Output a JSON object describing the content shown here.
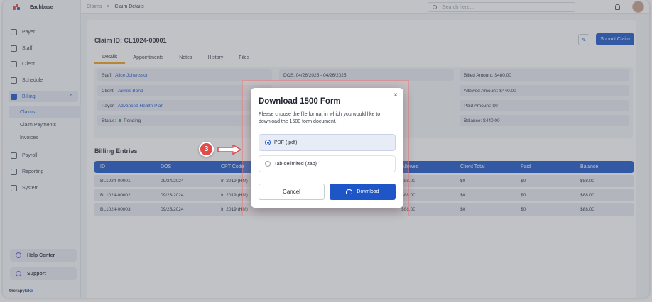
{
  "app": {
    "name": "Eachbase"
  },
  "colors": {
    "primary": "#1e56c8",
    "accent_tab": "#f0a017",
    "step_badge": "#e34b4b",
    "status_pending": "#2e9e4f"
  },
  "sidebar": {
    "items": [
      {
        "label": "Payer",
        "icon": "payer-icon"
      },
      {
        "label": "Staff",
        "icon": "staff-icon"
      },
      {
        "label": "Client",
        "icon": "client-icon"
      },
      {
        "label": "Schedule",
        "icon": "calendar-icon"
      },
      {
        "label": "Billing",
        "icon": "billing-icon",
        "active": true,
        "expanded": true
      },
      {
        "label": "Payroll",
        "icon": "payroll-icon"
      },
      {
        "label": "Reporting",
        "icon": "reporting-icon"
      },
      {
        "label": "System",
        "icon": "system-icon"
      }
    ],
    "billing_sub": [
      "Claims",
      "Claim Payments",
      "Invoices"
    ],
    "help_center": "Help Center",
    "support": "Support",
    "footer_brand_a": "therapy",
    "footer_brand_b": "lake"
  },
  "topbar": {
    "breadcrumb_root": "Claims",
    "breadcrumb_sep": ">",
    "breadcrumb_current": "Claim Details",
    "search_placeholder": "Search here..."
  },
  "claim": {
    "title": "Claim ID: CL1024-00001",
    "submit_label": "Submit Claim",
    "tabs": [
      "Details",
      "Appointments",
      "Notes",
      "History",
      "Files"
    ],
    "info": {
      "staff_label": "Staff:",
      "staff_value": "Alice Johansson",
      "client_label": "Client:",
      "client_value": "James Bond",
      "payer_label": "Payer:",
      "payer_value": "Advanced Health Plan",
      "status_label": "Status:",
      "status_value": "Pending",
      "dos_label": "DOS: 04/26/2025 - 04/26/2025",
      "billed": "Billed Amount: $480.00",
      "allowed": "Allowed Amount: $440.00",
      "paid": "Paid Amount: $0",
      "balance": "Balance: $440.00"
    }
  },
  "billing": {
    "title": "Billing Entries",
    "headers": [
      "ID",
      "DOS",
      "CPT Code",
      "",
      "Allowed",
      "Client Total",
      "Paid",
      "Balance"
    ],
    "rows": [
      [
        "BL1024-00001",
        "09/24/2024",
        "In 2019 (HM)",
        "",
        "$88.00",
        "$0",
        "$0",
        "$88.00"
      ],
      [
        "BL1024-00002",
        "09/23/2024",
        "In 2019 (HM)",
        "",
        "$88.00",
        "$0",
        "$0",
        "$88.00"
      ],
      [
        "BL1024-00003",
        "09/25/2024",
        "In 2019 (HM)",
        "",
        "$88.00",
        "$0",
        "$0",
        "$88.00"
      ]
    ]
  },
  "modal": {
    "title": "Download 1500 Form",
    "description": "Please choose the file format in which you would like to download the 1500 form document.",
    "options": [
      {
        "label": "PDF (.pdf)",
        "selected": true
      },
      {
        "label": "Tab-delimited (.tab)",
        "selected": false
      }
    ],
    "cancel_label": "Cancel",
    "download_label": "Download",
    "close_glyph": "×"
  },
  "step_badge": "3"
}
